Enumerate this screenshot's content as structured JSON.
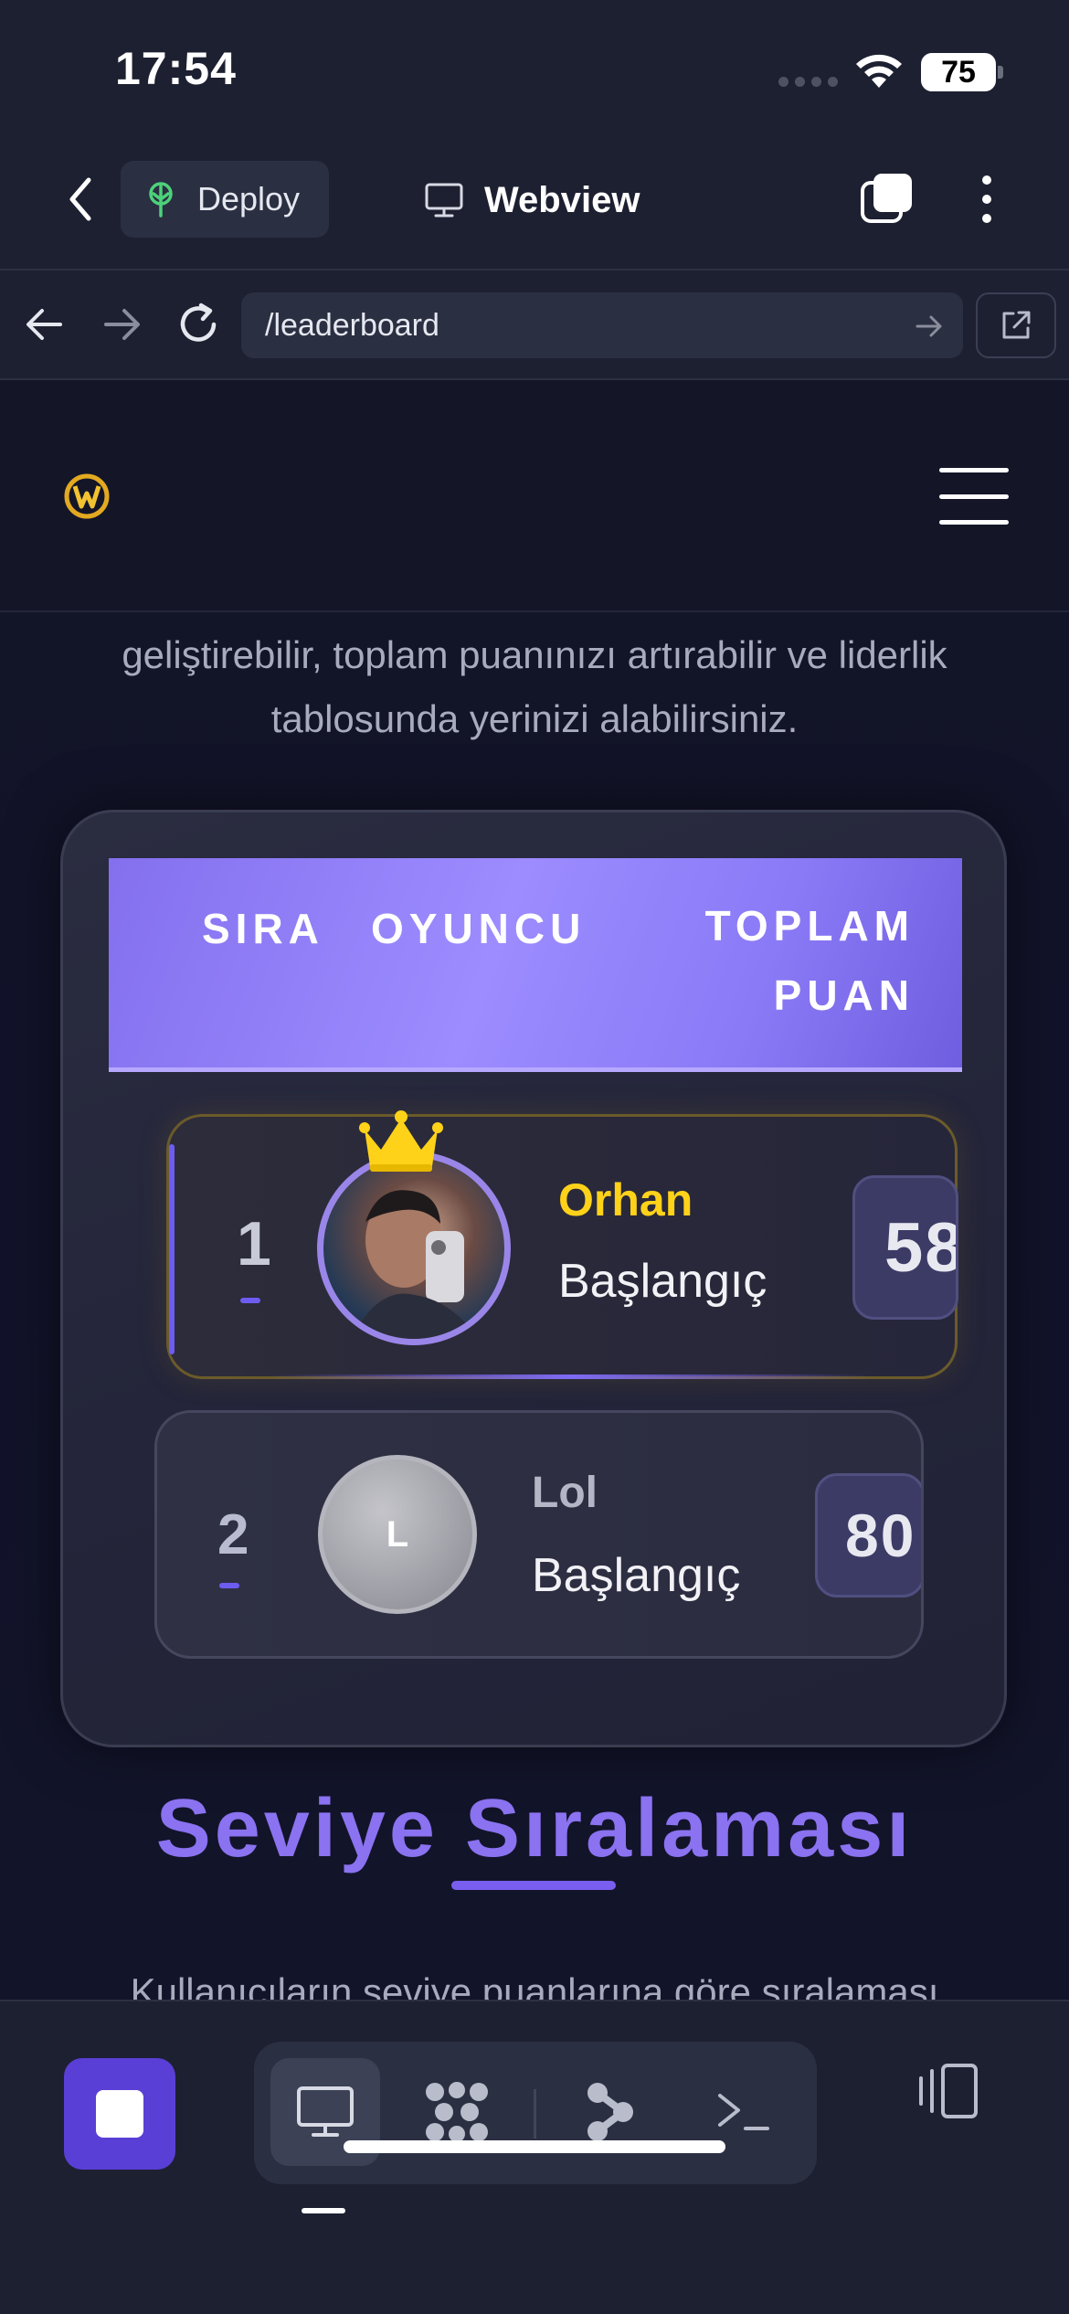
{
  "status_bar": {
    "time": "17:54",
    "battery": "75"
  },
  "toolbar": {
    "deploy_label": "Deploy",
    "webview_title": "Webview"
  },
  "url_bar": {
    "url": "/leaderboard"
  },
  "page": {
    "intro_text": "geliştirebilir, toplam puanınızı artırabilir ve liderlik tablosunda yerinizi alabilirsiniz.",
    "table_header": {
      "rank": "SIRA",
      "player": "OYUNCU",
      "score": "TOPLAM PUAN"
    },
    "rows": [
      {
        "rank": "1",
        "name": "Orhan",
        "tier": "Başlangıç",
        "score": "58"
      },
      {
        "rank": "2",
        "avatar_letter": "L",
        "name": "Lol",
        "tier": "Başlangıç",
        "score": "80"
      }
    ],
    "section_title": "Seviye Sıralaması",
    "section_subtitle": "Kullanıcıların seviye puanlarına göre sıralaması"
  },
  "colors": {
    "accent": "#8a72f0",
    "header_gradient": "#9c8cff",
    "gold": "#ffd21a",
    "stop_button": "#5a3fd6"
  },
  "icons": [
    "back-icon",
    "deploy-icon",
    "monitor-icon",
    "tabs-icon",
    "kebab-icon",
    "arrow-left-icon",
    "arrow-right-icon",
    "reload-icon",
    "external-link-icon",
    "logo-icon",
    "hamburger-icon",
    "crown-icon",
    "stop-icon",
    "dots-grid-icon",
    "branch-icon",
    "terminal-icon",
    "panel-icon"
  ]
}
